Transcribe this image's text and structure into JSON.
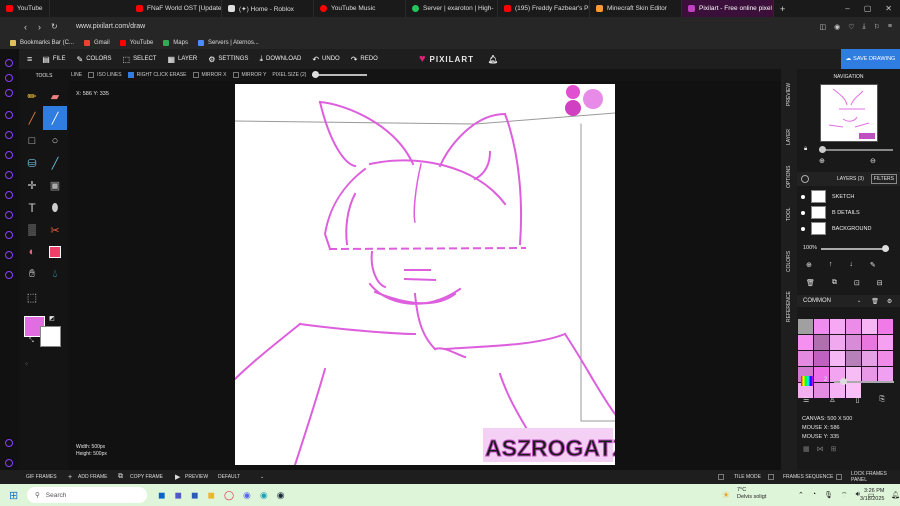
{
  "browser": {
    "tabs": [
      {
        "label": "YouTube",
        "color": "#ff0000"
      },
      {
        "label": "FNaF World OST [Update",
        "color": "#ff0000"
      },
      {
        "label": "(✦) Home - Roblox",
        "color": "#dddddd"
      },
      {
        "label": "YouTube Music",
        "color": "#ff0000"
      },
      {
        "label": "Server | exaroton | High-",
        "color": "#23c55e"
      },
      {
        "label": "(195) Freddy Fazbear's Pi",
        "color": "#ff0000"
      },
      {
        "label": "Minecraft Skin Editor",
        "color": "#ff9933"
      },
      {
        "label": "Pixilart - Free online pixel",
        "color": "#c040c0"
      }
    ],
    "new_tab": "+",
    "url": "www.pixilart.com/draw",
    "bookmarks": [
      "Bookmarks Bar (C...",
      "Gmail",
      "YouTube",
      "Maps",
      "Servers | Aternos..."
    ]
  },
  "app": {
    "logo": "PIXILART",
    "menu": [
      "FILE",
      "COLORS",
      "SELECT",
      "LAYER",
      "SETTINGS",
      "DOWNLOAD",
      "UNDO",
      "REDO"
    ],
    "save_button": "SAVE DRAWING",
    "accent": "#e040c8"
  },
  "toolbar2": {
    "line": "LINE",
    "iso_lines": "ISO LINES",
    "right_click_erase": "RIGHT CLICK ERASE",
    "mirror_x": "MIRROR X",
    "mirror_y": "MIRROR Y",
    "pixel_size": "PIXEL SIZE (2)",
    "pixel_size_value": 2
  },
  "tools": {
    "title": "TOOLS",
    "primary_color": "#e06ee0",
    "secondary_color": "#ffffff"
  },
  "workspace": {
    "coords": "X: 586 Y: 335",
    "width": "Width: 500px",
    "height": "Height: 500px",
    "signature": "ASZROGATZ"
  },
  "right": {
    "vertical_tabs": [
      "PREVIEW",
      "LAYER",
      "OPTIONS",
      "TOOL",
      "COLORS",
      "REFERENCE"
    ],
    "navigation": "NAVIGATION",
    "layers_title": "LAYERS (3)",
    "filters": "FILTERS",
    "layers": [
      "SKETCH",
      "B DETAILS",
      "BACKGROUND"
    ],
    "opacity": "100%",
    "palette_name": "COMMON",
    "brush_size": "2",
    "canvas_info": "CANVAS: 500 X 500",
    "mouse_x": "MOUSE X: 586",
    "mouse_y": "MOUSE Y: 335",
    "palette": [
      "#a0a0a0",
      "#f08cf0",
      "#f7a8f5",
      "#ec8ce8",
      "#f7b6f3",
      "#f07ae8",
      "#f590f0",
      "#b070b0",
      "#f0a8ee",
      "#d88cd8",
      "#e878e0",
      "#f5a0f0",
      "#e48ae0",
      "#c060c0",
      "#f6b8f4",
      "#b880b8",
      "#e6a0e6",
      "#f08ce8",
      "#d07ad0",
      "#ee70e8",
      "#f3a4f1",
      "#f5bdf3",
      "#e898e6",
      "#f0a0f0",
      "#f2aef0",
      "#e48ce2",
      "#f6b0f4",
      "#f8c0f6"
    ]
  },
  "bottom": {
    "gif_frames": "GIF FRAMES",
    "add_frame": "ADD FRAME",
    "copy_frame": "COPY FRAME",
    "preview": "PREVIEW",
    "default": "DEFAULT",
    "tile_mode": "TILE MODE",
    "frames_sequence": "FRAMES SEQUENCE",
    "lock_frames": "LOCK FRAMES PANEL"
  },
  "taskbar": {
    "search": "Search",
    "weather_temp": "7°C",
    "weather_desc": "Delvis soligt",
    "time": "3:26 PM",
    "date": "3/18/2025"
  }
}
